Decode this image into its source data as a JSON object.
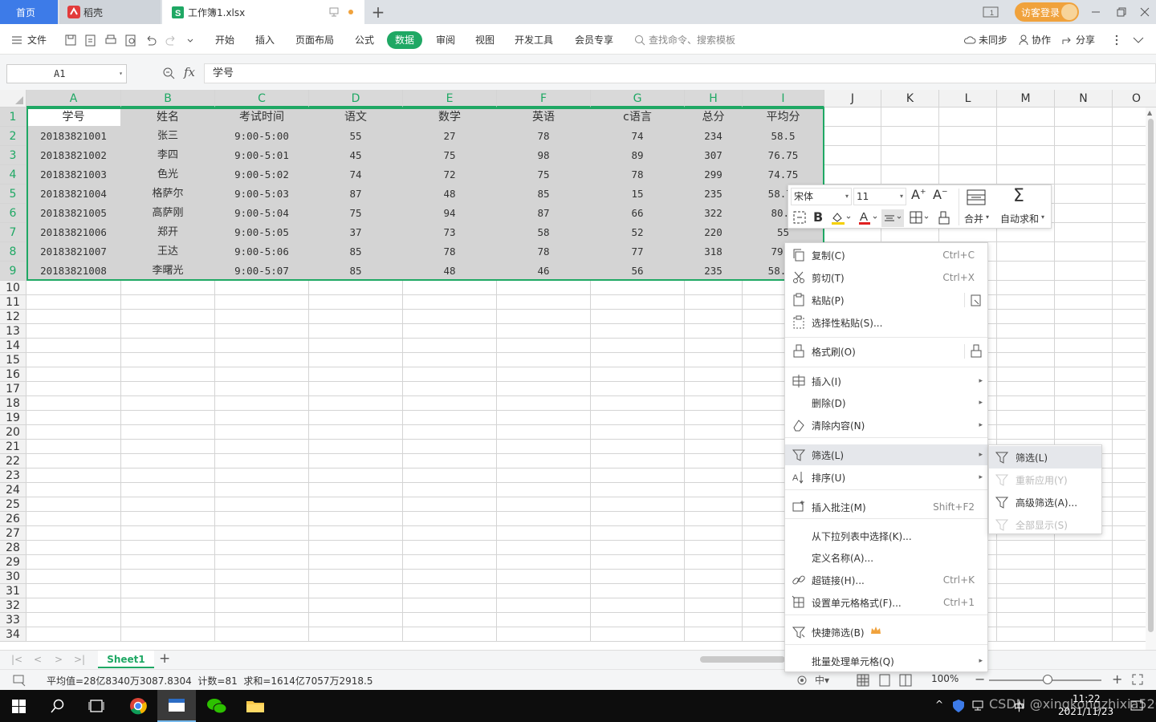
{
  "tabs": {
    "home": "首页",
    "daoke": "稻壳",
    "file": "工作簿1.xlsx"
  },
  "titlebar": {
    "login": "访客登录"
  },
  "menu": {
    "file": "文件",
    "items": [
      "开始",
      "插入",
      "页面布局",
      "公式",
      "数据",
      "审阅",
      "视图",
      "开发工具",
      "会员专享"
    ],
    "active_item": "数据",
    "search_placeholder": "查找命令、搜索模板",
    "unsync": "未同步",
    "collab": "协作",
    "share": "分享"
  },
  "formula": {
    "cell_ref": "A1",
    "fx": "fx",
    "content": "学号"
  },
  "columns": [
    "A",
    "B",
    "C",
    "D",
    "E",
    "F",
    "G",
    "H",
    "I",
    "J",
    "K",
    "L",
    "M",
    "N",
    "O"
  ],
  "rows_count": 34,
  "table": {
    "headers": [
      "学号",
      "姓名",
      "考试时间",
      "语文",
      "数学",
      "英语",
      "c语言",
      "总分",
      "平均分"
    ],
    "rows": [
      [
        "20183821001",
        "张三",
        "9:00-5:00",
        "55",
        "27",
        "78",
        "74",
        "234",
        "58.5"
      ],
      [
        "20183821002",
        "李四",
        "9:00-5:01",
        "45",
        "75",
        "98",
        "89",
        "307",
        "76.75"
      ],
      [
        "20183821003",
        "色光",
        "9:00-5:02",
        "74",
        "72",
        "75",
        "78",
        "299",
        "74.75"
      ],
      [
        "20183821004",
        "格萨尔",
        "9:00-5:03",
        "87",
        "48",
        "85",
        "15",
        "235",
        "58.75"
      ],
      [
        "20183821005",
        "高萨刚",
        "9:00-5:04",
        "75",
        "94",
        "87",
        "66",
        "322",
        "80.5"
      ],
      [
        "20183821006",
        "郑开",
        "9:00-5:05",
        "37",
        "73",
        "58",
        "52",
        "220",
        "55"
      ],
      [
        "20183821007",
        "王达",
        "9:00-5:06",
        "85",
        "78",
        "78",
        "77",
        "318",
        "79.5"
      ],
      [
        "20183821008",
        "李曙光",
        "9:00-5:07",
        "85",
        "48",
        "46",
        "56",
        "235",
        "58.75"
      ]
    ]
  },
  "mini_toolbar": {
    "font": "宋体",
    "size": "11",
    "merge": "合并",
    "autosum": "自动求和"
  },
  "context_menu": [
    {
      "label": "复制(C)",
      "shortcut": "Ctrl+C",
      "icon": "copy-icon"
    },
    {
      "label": "剪切(T)",
      "shortcut": "Ctrl+X",
      "icon": "cut-icon"
    },
    {
      "label": "粘贴(P)",
      "shortcut": "",
      "icon": "paste-icon"
    },
    {
      "label": "选择性粘贴(S)...",
      "shortcut": "",
      "icon": "paste-special-icon"
    },
    {
      "label": "格式刷(O)",
      "shortcut": "",
      "icon": "format-brush-icon"
    },
    {
      "label": "插入(I)",
      "shortcut": "",
      "icon": "insert-icon"
    },
    {
      "label": "删除(D)",
      "shortcut": "",
      "icon": ""
    },
    {
      "label": "清除内容(N)",
      "shortcut": "",
      "icon": "clear-icon"
    },
    {
      "label": "筛选(L)",
      "shortcut": "",
      "icon": "filter-icon"
    },
    {
      "label": "排序(U)",
      "shortcut": "",
      "icon": "sort-icon"
    },
    {
      "label": "插入批注(M)",
      "shortcut": "Shift+F2",
      "icon": "comment-icon"
    },
    {
      "label": "从下拉列表中选择(K)...",
      "shortcut": "",
      "icon": ""
    },
    {
      "label": "定义名称(A)...",
      "shortcut": "",
      "icon": ""
    },
    {
      "label": "超链接(H)...",
      "shortcut": "Ctrl+K",
      "icon": "link-icon"
    },
    {
      "label": "设置单元格格式(F)...",
      "shortcut": "Ctrl+1",
      "icon": "cell-format-icon"
    },
    {
      "label": "快捷筛选(B)",
      "shortcut": "",
      "icon": "quick-filter-icon"
    },
    {
      "label": "批量处理单元格(Q)",
      "shortcut": "",
      "icon": ""
    }
  ],
  "submenu": [
    {
      "label": "筛选(L)",
      "enabled": true
    },
    {
      "label": "重新应用(Y)",
      "enabled": false
    },
    {
      "label": "高级筛选(A)...",
      "enabled": true
    },
    {
      "label": "全部显示(S)",
      "enabled": false
    }
  ],
  "sheet": {
    "name": "Sheet1"
  },
  "status": {
    "summary": "平均值=28亿8340万3087.8304  计数=81  求和=1614亿7057万2918.5",
    "zoom": "100%"
  },
  "taskbar": {
    "time": "11:22",
    "date": "2021/11/23",
    "lang": "中",
    "watermark": "CSDN @xingkongzhixia520"
  },
  "colors": {
    "accent": "#1fa864",
    "tab_blue": "#3d7be8",
    "login_orange": "#f0a23c"
  }
}
